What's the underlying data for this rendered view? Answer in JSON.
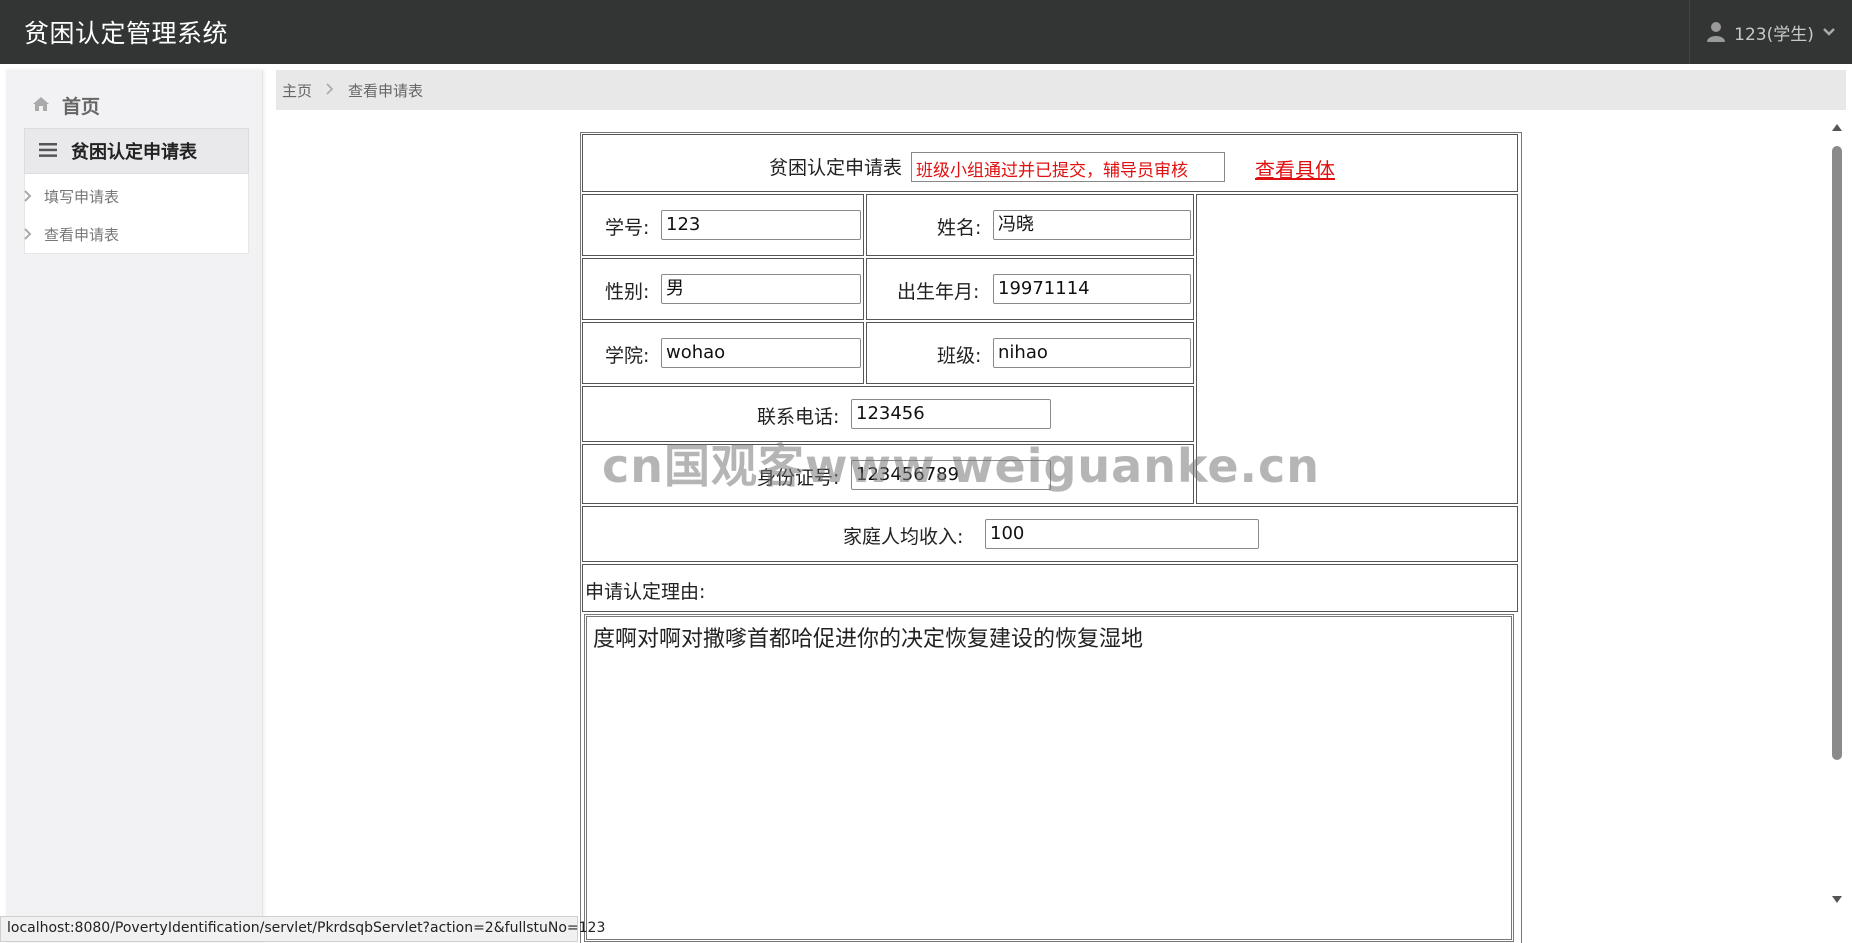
{
  "app": {
    "title": "贫困认定管理系统",
    "user_label": "123(学生)"
  },
  "sidebar": {
    "home_label": "首页",
    "group_label": "贫困认定申请表",
    "items": [
      {
        "label": "填写申请表"
      },
      {
        "label": "查看申请表"
      }
    ]
  },
  "breadcrumb": {
    "home": "主页",
    "current": "查看申请表"
  },
  "form": {
    "title": "贫困认定申请表",
    "status_text": "班级小组通过并已提交，辅导员审核",
    "view_link": "查看具体",
    "student_id_label": "学号:",
    "student_id": "123",
    "name_label": "姓名:",
    "name": "冯晓",
    "gender_label": "性别:",
    "gender": "男",
    "birth_label": "出生年月:",
    "birth": "19971114",
    "college_label": "学院:",
    "college": "wohao",
    "class_label": "班级:",
    "class": "nihao",
    "phone_label": "联系电话:",
    "phone": "123456",
    "id_card_label": "身份证号:",
    "id_card": "123456789",
    "income_label": "家庭人均收入:",
    "income": "100",
    "reason_label": "申请认定理由:",
    "reason": "度啊对啊对撒嗲首都哈促进你的决定恢复建设的恢复湿地"
  },
  "watermark": "cn国观客www.weiguanke.cn",
  "status_bar": {
    "url": "localhost:8080/PovertyIdentification/servlet/PkrdsqbServlet?action=2&fullstuNo=123"
  }
}
